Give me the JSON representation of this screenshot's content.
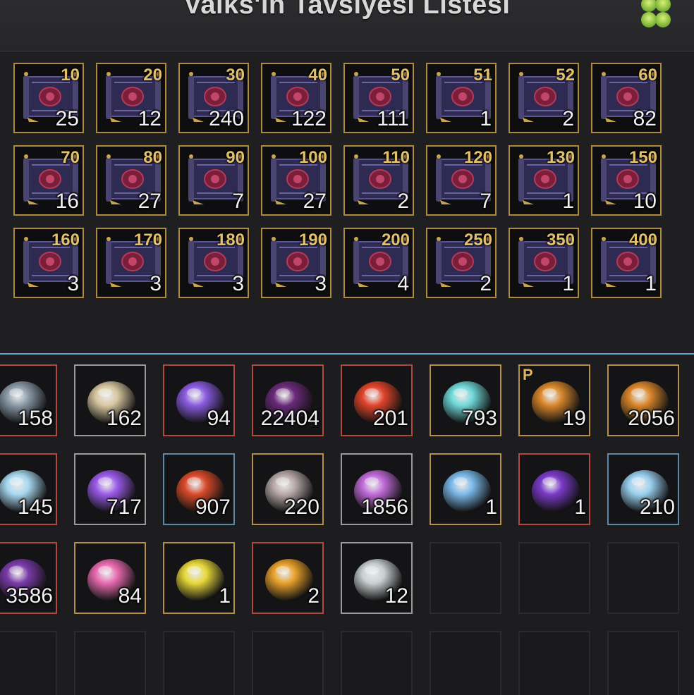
{
  "header": {
    "title": "Valks'ın Tavsiyesi Listesi",
    "clover_icon": "four-leaf-clover-icon"
  },
  "scroll_panel": {
    "icon": "advice-of-valks-scroll-icon",
    "items": [
      {
        "level": "10",
        "count": "25"
      },
      {
        "level": "20",
        "count": "12"
      },
      {
        "level": "30",
        "count": "240"
      },
      {
        "level": "40",
        "count": "122"
      },
      {
        "level": "50",
        "count": "111"
      },
      {
        "level": "51",
        "count": "1"
      },
      {
        "level": "52",
        "count": "2"
      },
      {
        "level": "60",
        "count": "82"
      },
      {
        "level": "70",
        "count": "16"
      },
      {
        "level": "80",
        "count": "27"
      },
      {
        "level": "90",
        "count": "7"
      },
      {
        "level": "100",
        "count": "27"
      },
      {
        "level": "110",
        "count": "2"
      },
      {
        "level": "120",
        "count": "7"
      },
      {
        "level": "130",
        "count": "1"
      },
      {
        "level": "150",
        "count": "10"
      },
      {
        "level": "160",
        "count": "3"
      },
      {
        "level": "170",
        "count": "3"
      },
      {
        "level": "180",
        "count": "3"
      },
      {
        "level": "190",
        "count": "3"
      },
      {
        "level": "200",
        "count": "4"
      },
      {
        "level": "250",
        "count": "2"
      },
      {
        "level": "350",
        "count": "1"
      },
      {
        "level": "400",
        "count": "1"
      }
    ]
  },
  "inventory": {
    "items": [
      {
        "icon": "grey-stone-icon",
        "count": "158",
        "border": "red",
        "color": "#8a9aa8"
      },
      {
        "icon": "white-gold-stone-icon",
        "count": "162",
        "border": "silver",
        "color": "#d8c8a0"
      },
      {
        "icon": "purple-crystal-icon",
        "count": "94",
        "border": "red",
        "color": "#8a5ae0"
      },
      {
        "icon": "dark-shard-icon",
        "count": "22404",
        "border": "red",
        "color": "#6a2a7a"
      },
      {
        "icon": "red-stone-icon",
        "count": "201",
        "border": "red",
        "color": "#e0442a"
      },
      {
        "icon": "cyan-orb-icon",
        "count": "793",
        "border": "gold",
        "color": "#6fd8d8"
      },
      {
        "icon": "golden-medallion-icon",
        "count": "19",
        "border": "gold",
        "color": "#d8862a",
        "mark": "P"
      },
      {
        "icon": "golden-medallion-icon",
        "count": "2056",
        "border": "gold",
        "color": "#d8862a"
      },
      {
        "icon": "blue-crystal-icon",
        "count": "145",
        "border": "red",
        "color": "#a8d8f0"
      },
      {
        "icon": "violet-stone-icon",
        "count": "717",
        "border": "silver",
        "color": "#9a5ae8"
      },
      {
        "icon": "red-ember-stone-icon",
        "count": "907",
        "border": "blue",
        "color": "#d84a2a"
      },
      {
        "icon": "silver-stone-icon",
        "count": "220",
        "border": "gold",
        "color": "#b8a8a8"
      },
      {
        "icon": "pink-crystal-icon",
        "count": "1856",
        "border": "silver",
        "color": "#c06ad8"
      },
      {
        "icon": "ice-crystal-cluster-icon",
        "count": "1",
        "border": "gold",
        "color": "#7ab8e8"
      },
      {
        "icon": "dark-purple-stone-icon",
        "count": "1",
        "border": "red",
        "color": "#7a3ac8"
      },
      {
        "icon": "glowing-blue-gem-icon",
        "count": "210",
        "border": "blue",
        "color": "#9ad0f0"
      },
      {
        "icon": "purple-nebula-orb-icon",
        "count": "3586",
        "border": "red",
        "color": "#7a3aa8"
      },
      {
        "icon": "pink-spiral-galaxy-icon",
        "count": "84",
        "border": "gold",
        "color": "#e86ab0"
      },
      {
        "icon": "yellow-crystal-icon",
        "count": "1",
        "border": "gold",
        "color": "#e8d83a"
      },
      {
        "icon": "amber-stone-icon",
        "count": "2",
        "border": "red",
        "color": "#e8a02a"
      },
      {
        "icon": "silver-orb-icon",
        "count": "12",
        "border": "silver",
        "color": "#c8d0d0"
      },
      {
        "icon": "",
        "count": "",
        "border": "empty"
      },
      {
        "icon": "",
        "count": "",
        "border": "empty"
      },
      {
        "icon": "",
        "count": "",
        "border": "empty"
      },
      {
        "icon": "",
        "count": "",
        "border": "empty"
      },
      {
        "icon": "",
        "count": "",
        "border": "empty"
      },
      {
        "icon": "",
        "count": "",
        "border": "empty"
      },
      {
        "icon": "",
        "count": "",
        "border": "empty"
      },
      {
        "icon": "",
        "count": "",
        "border": "empty"
      },
      {
        "icon": "",
        "count": "",
        "border": "empty"
      },
      {
        "icon": "",
        "count": "",
        "border": "empty"
      },
      {
        "icon": "",
        "count": "",
        "border": "empty"
      }
    ]
  }
}
